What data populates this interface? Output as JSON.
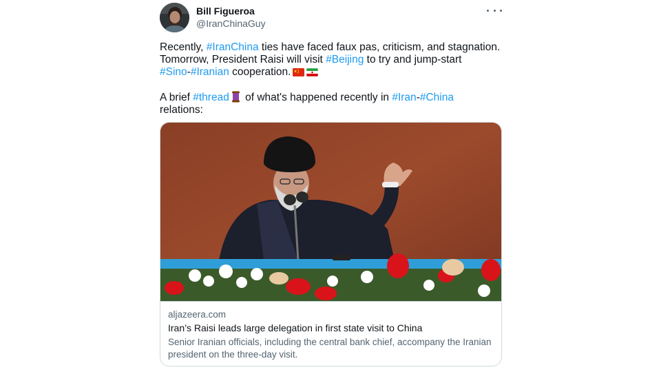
{
  "tweet": {
    "author_name": "Bill Figueroa",
    "author_handle": "@IranChinaGuy",
    "more_icon": "more-options-icon",
    "body": {
      "l1_pre": "Recently, ",
      "l1_tag": "#IranChina",
      "l1_post": " ties have faced faux pas, criticism, and stagnation.",
      "l2_pre": "Tomorrow, President Raisi will visit ",
      "l2_tag": "#Beijing",
      "l2_post": " to try and jump-start",
      "l3_tag1": "#Sino",
      "l3_dash": "-",
      "l3_tag2": "#Iranian",
      "l3_post": " cooperation.",
      "l4_pre": "A brief ",
      "l4_tag": "#thread",
      "l4_mid": " of what's happened recently in ",
      "l4_tag2": "#Iran",
      "l4_dash": "-",
      "l4_tag3": "#China",
      "l5": "relations:"
    },
    "hashtag_color": "#1d9bf0",
    "card": {
      "domain": "aljazeera.com",
      "title": "Iran’s Raisi leads large delegation in first state visit to China",
      "description": "Senior Iranian officials, including the central bank chief, accompany the Iranian president on the three-day visit."
    }
  }
}
